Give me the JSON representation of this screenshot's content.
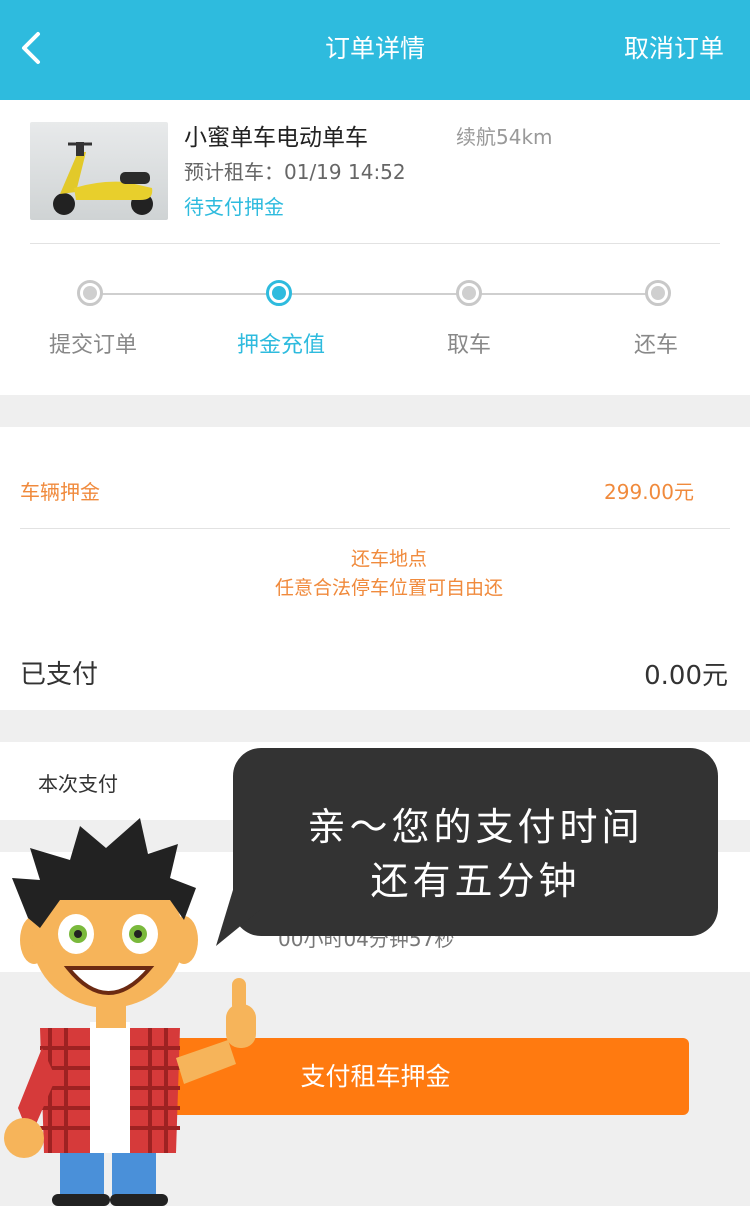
{
  "header": {
    "title": "订单详情",
    "cancel_label": "取消订单"
  },
  "order": {
    "bike_name": "小蜜单车电动单车",
    "range": "续航54km",
    "rent_time": "预计租车：01/19 14:52",
    "status": "待支付押金"
  },
  "steps": [
    {
      "label": "提交订单",
      "active": false
    },
    {
      "label": "押金充值",
      "active": true
    },
    {
      "label": "取车",
      "active": false
    },
    {
      "label": "还车",
      "active": false
    }
  ],
  "deposit": {
    "label": "车辆押金",
    "amount": "299.00元",
    "return_title": "还车地点",
    "return_desc": "任意合法停车位置可自由还",
    "paid_label": "已支付",
    "paid_amount": "0.00元"
  },
  "payment": {
    "current_label": "本次支付",
    "timer_partial": "00小时04分钟57秒",
    "button_label": "支付租车押金"
  },
  "bubble": {
    "line1": "亲～您的支付时间",
    "line2": "还有五分钟"
  },
  "colors": {
    "accent": "#2ebbde",
    "orange": "#ff7a10",
    "deposit_text": "#f08a3c"
  }
}
